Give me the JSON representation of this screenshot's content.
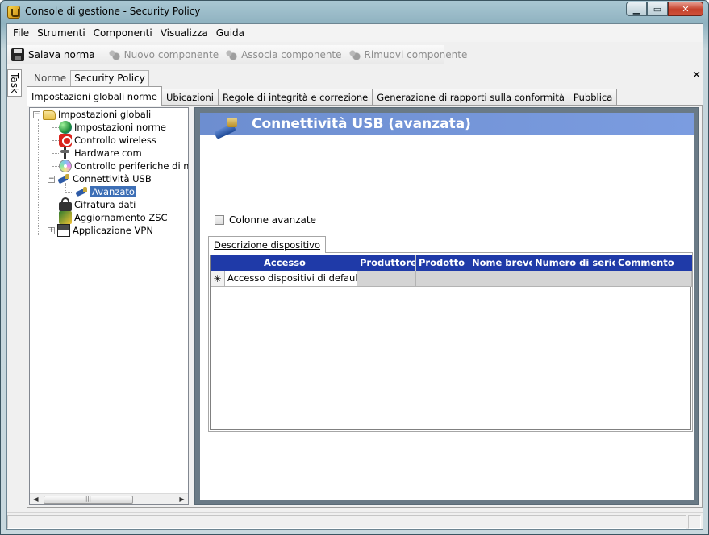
{
  "window": {
    "title": "Console di gestione  - Security Policy"
  },
  "menu": [
    "File",
    "Strumenti",
    "Componenti",
    "Visualizza",
    "Guida"
  ],
  "toolbar": {
    "save": "Salava norma",
    "new_component": "Nuovo componente",
    "associate_component": "Associa componente",
    "remove_component": "Rimuovi componente"
  },
  "task_tab": "Task",
  "doc_tabs": [
    "Norme",
    "Security Policy"
  ],
  "section_tabs": [
    "Impostazioni globali norme",
    "Ubicazioni",
    "Regole di integrità e correzione",
    "Generazione di rapporti sulla conformità",
    "Pubblica"
  ],
  "tree": {
    "root": "Impostazioni globali",
    "items": [
      "Impostazioni norme",
      "Controllo wireless",
      "Hardware com",
      "Controllo periferiche di me",
      "Connettività USB",
      "Avanzato",
      "Cifratura dati",
      "Aggiornamento ZSC",
      "Applicazione VPN"
    ]
  },
  "panel": {
    "title": "Connettività USB (avanzata)",
    "checkbox_label": "Colonne avanzate",
    "device_tab": "Descrizione dispositivo",
    "grid": {
      "columns": [
        "Accesso",
        "Produttore",
        "Prodotto",
        "Nome breve",
        "Numero di serie",
        "Commento"
      ],
      "rows": [
        {
          "marker": "✳",
          "cells": [
            "Accesso dispositivi di default",
            "",
            "",
            "",
            "",
            ""
          ]
        }
      ]
    }
  }
}
